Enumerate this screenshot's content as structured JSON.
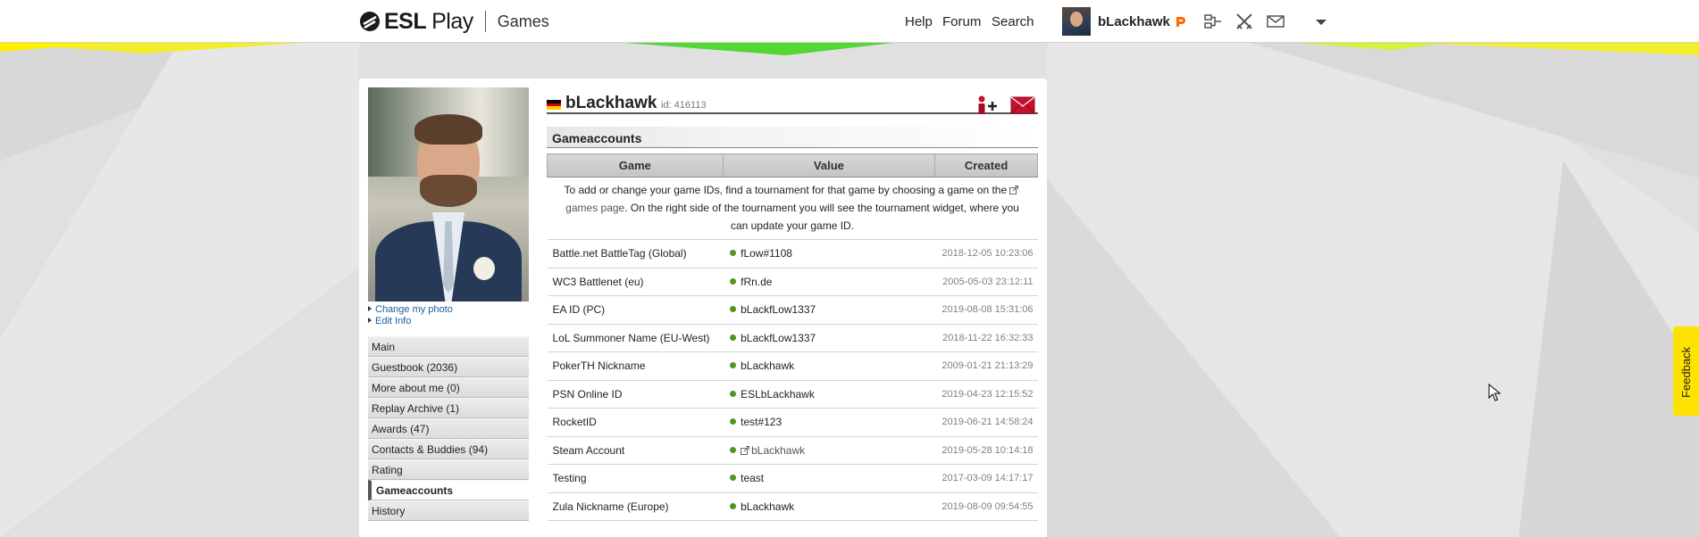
{
  "header": {
    "logo_brand": "ESL",
    "logo_play": "Play",
    "section": "Games",
    "nav": {
      "help": "Help",
      "forum": "Forum",
      "search": "Search"
    },
    "username": "bLackhawk",
    "icons": [
      "premium-badge-icon",
      "bracket-icon",
      "crossed-swords-icon",
      "envelope-icon",
      "chevron-down-icon"
    ]
  },
  "profile": {
    "name": "bLackhawk",
    "id_text": "id: 416113",
    "links": {
      "change_photo": "Change my photo",
      "edit_info": "Edit Info"
    },
    "menu": [
      {
        "label": "Main"
      },
      {
        "label": "Guestbook (2036)"
      },
      {
        "label": "More about me (0)"
      },
      {
        "label": "Replay Archive (1)"
      },
      {
        "label": "Awards (47)"
      },
      {
        "label": "Contacts & Buddies (94)"
      },
      {
        "label": "Rating"
      },
      {
        "label": "Gameaccounts",
        "active": true
      },
      {
        "label": "History"
      }
    ]
  },
  "gameaccounts": {
    "title": "Gameaccounts",
    "columns": {
      "game": "Game",
      "value": "Value",
      "created": "Created"
    },
    "note_before": "To add or change your game IDs, find a tournament for that game by choosing a game on the",
    "note_link": "games page",
    "note_after": ". On the right side of the tournament you will see the tournament widget, where you can update your game ID.",
    "rows": [
      {
        "game": "Battle.net BattleTag (Global)",
        "value": "fLow#1108",
        "created": "2018-12-05 10:23:06"
      },
      {
        "game": "WC3 Battlenet (eu)",
        "value": "fRn.de",
        "created": "2005-05-03 23:12:11"
      },
      {
        "game": "EA ID (PC)",
        "value": "bLackfLow1337",
        "created": "2019-08-08 15:31:06"
      },
      {
        "game": "LoL Summoner Name (EU-West)",
        "value": "bLackfLow1337",
        "created": "2018-11-22 16:32:33"
      },
      {
        "game": "PokerTH Nickname",
        "value": "bLackhawk",
        "created": "2009-01-21 21:13:29"
      },
      {
        "game": "PSN Online ID",
        "value": "ESLbLackhawk",
        "created": "2019-04-23 12:15:52"
      },
      {
        "game": "RocketID",
        "value": "test#123",
        "created": "2019-06-21 14:58:24"
      },
      {
        "game": "Steam Account",
        "value": "bLackhawk",
        "created": "2019-05-28 10:14:18"
      },
      {
        "game": "Testing",
        "value": "teast",
        "created": "2017-03-09 14:17:17"
      },
      {
        "game": "Zula Nickname (Europe)",
        "value": "bLackhawk",
        "created": "2019-08-09 09:54:55"
      }
    ]
  },
  "feedback": "Feedback",
  "colors": {
    "status_dot": "#4a9a1e",
    "accent_green": "#44d62c",
    "accent_yellow": "#ffe300",
    "mail_red": "#c8102e"
  }
}
